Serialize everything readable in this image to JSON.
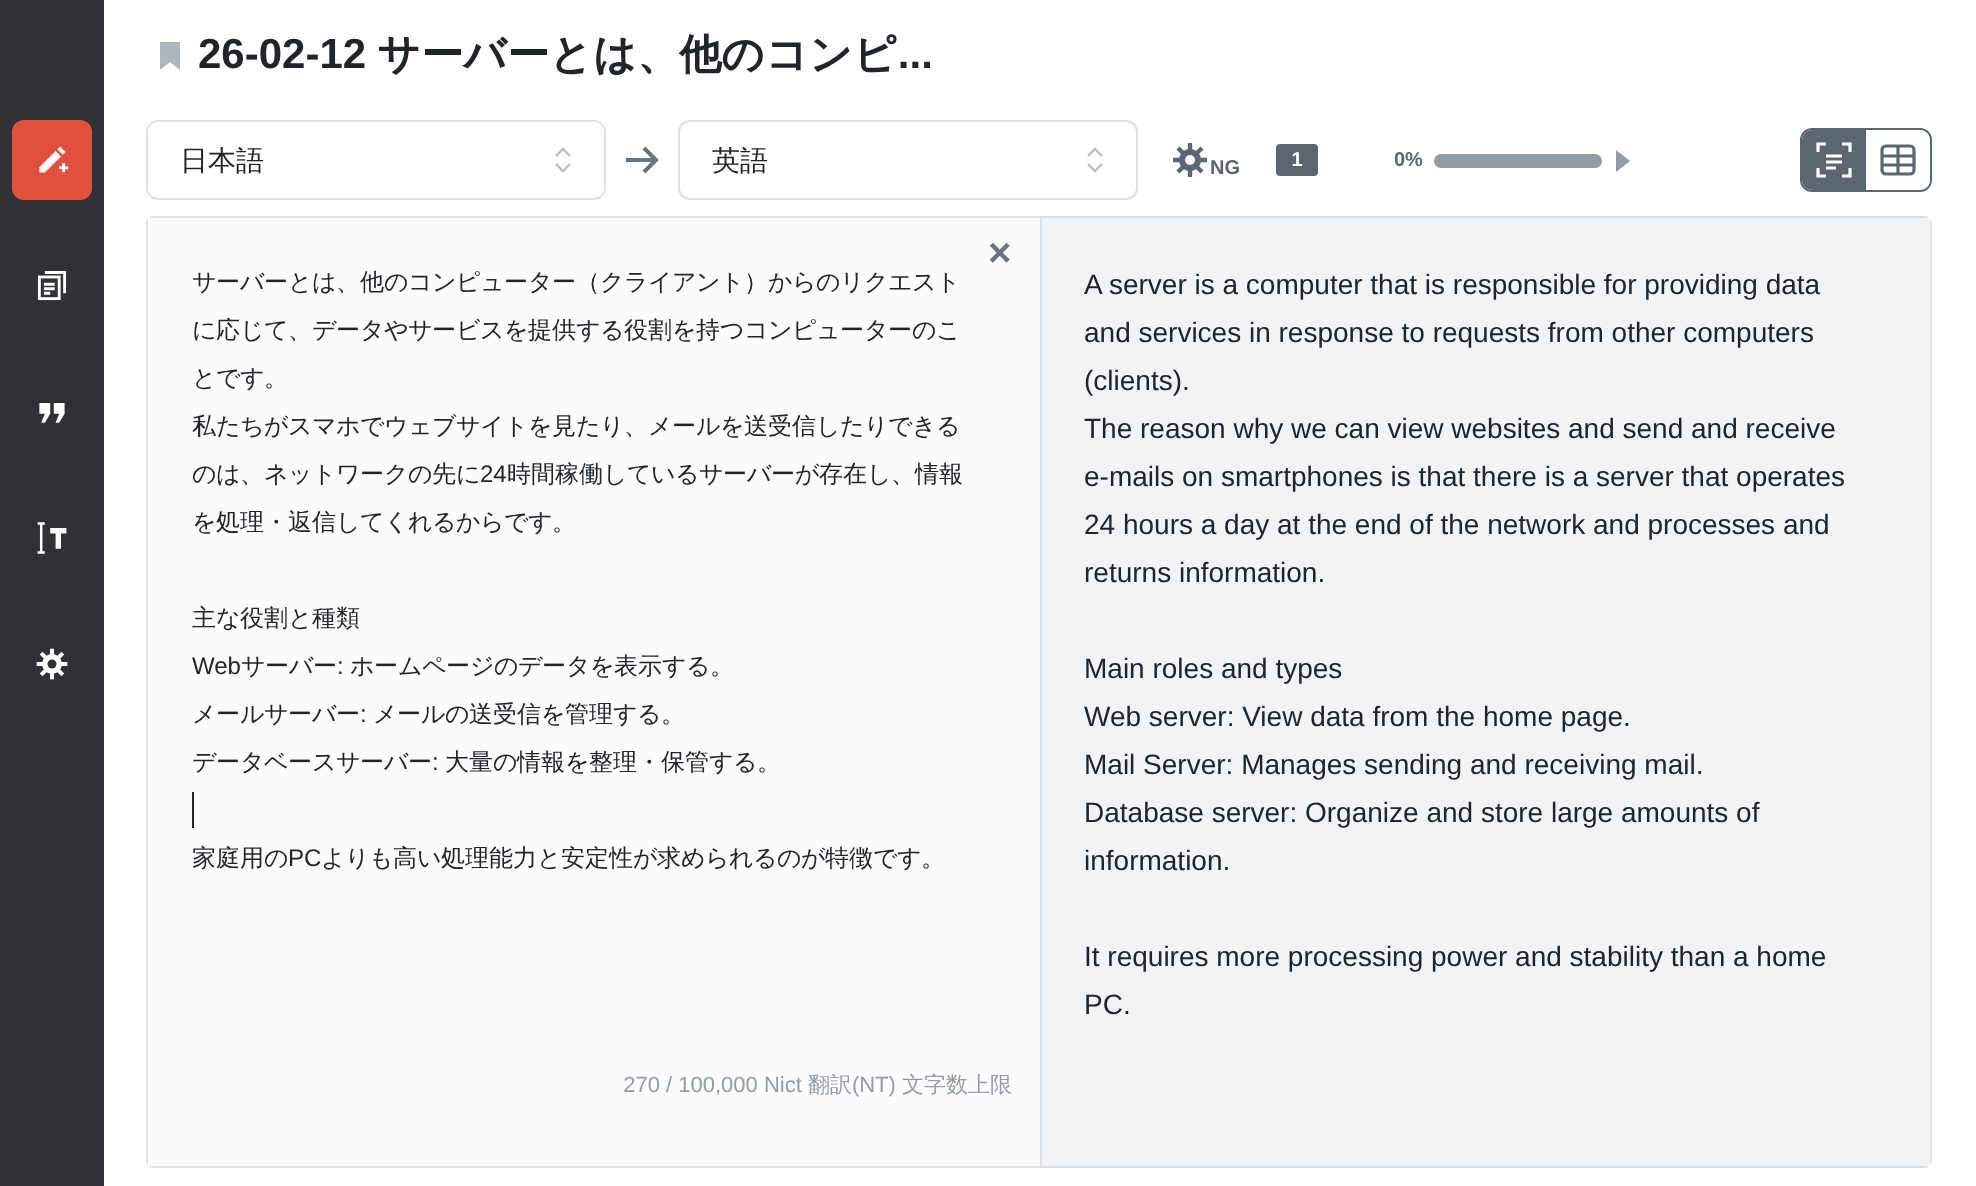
{
  "sidebar": {
    "items": [
      {
        "selected": true
      },
      {
        "selected": false
      },
      {
        "selected": false
      },
      {
        "selected": false
      },
      {
        "selected": false
      }
    ]
  },
  "header": {
    "title": "26-02-12 サーバーとは、他のコンピ..."
  },
  "toolbar": {
    "source_language": "日本語",
    "target_language": "英語",
    "ng_label": "NG",
    "folder_count": "1",
    "progress_text": "0%",
    "progress": {
      "level": 0
    },
    "views": [
      {
        "selected": true
      },
      {
        "selected": false
      }
    ]
  },
  "source": {
    "lines": [
      {
        "kind": "text",
        "text": "サーバーとは、他のコンピューター（クライアント）からのリクエストに応じて、データやサービスを提供する役割を持つコンピューターのことです。"
      },
      {
        "kind": "text",
        "text": "私たちがスマホでウェブサイトを見たり、メールを送受信したりできるのは、ネットワークの先に24時間稼働しているサーバーが存在し、情報を処理・返信してくれるからです。"
      },
      {
        "kind": "blank"
      },
      {
        "kind": "text",
        "text": "主な役割と種類"
      },
      {
        "kind": "text",
        "text": "Webサーバー: ホームページのデータを表示する。"
      },
      {
        "kind": "text",
        "text": "メールサーバー: メールの送受信を管理する。"
      },
      {
        "kind": "text",
        "text": "データベースサーバー: 大量の情報を整理・保管する。"
      },
      {
        "kind": "cursor"
      },
      {
        "kind": "text",
        "text": "家庭用のPCよりも高い処理能力と安定性が求められるのが特徴です。"
      }
    ],
    "close": "×",
    "counter": "270 / 100,000 Nict 翻訳(NT) 文字数上限"
  },
  "target": {
    "lines": [
      {
        "kind": "text",
        "text": "A server is a computer that is responsible for providing data and services in response to requests from other computers (clients)."
      },
      {
        "kind": "text",
        "text": "The reason why we can view websites and send and receive e-mails on smartphones is that there is a server that operates 24 hours a day at the end of the network and processes and returns information."
      },
      {
        "kind": "blank"
      },
      {
        "kind": "text",
        "text": "Main roles and types"
      },
      {
        "kind": "text",
        "text": "Web server: View data from the home page."
      },
      {
        "kind": "text",
        "text": "Mail Server: Manages sending and receiving mail."
      },
      {
        "kind": "text",
        "text": "Database server: Organize and store large amounts of information."
      },
      {
        "kind": "blank"
      },
      {
        "kind": "text",
        "text": "It requires more processing power and stability than a home PC."
      }
    ]
  }
}
